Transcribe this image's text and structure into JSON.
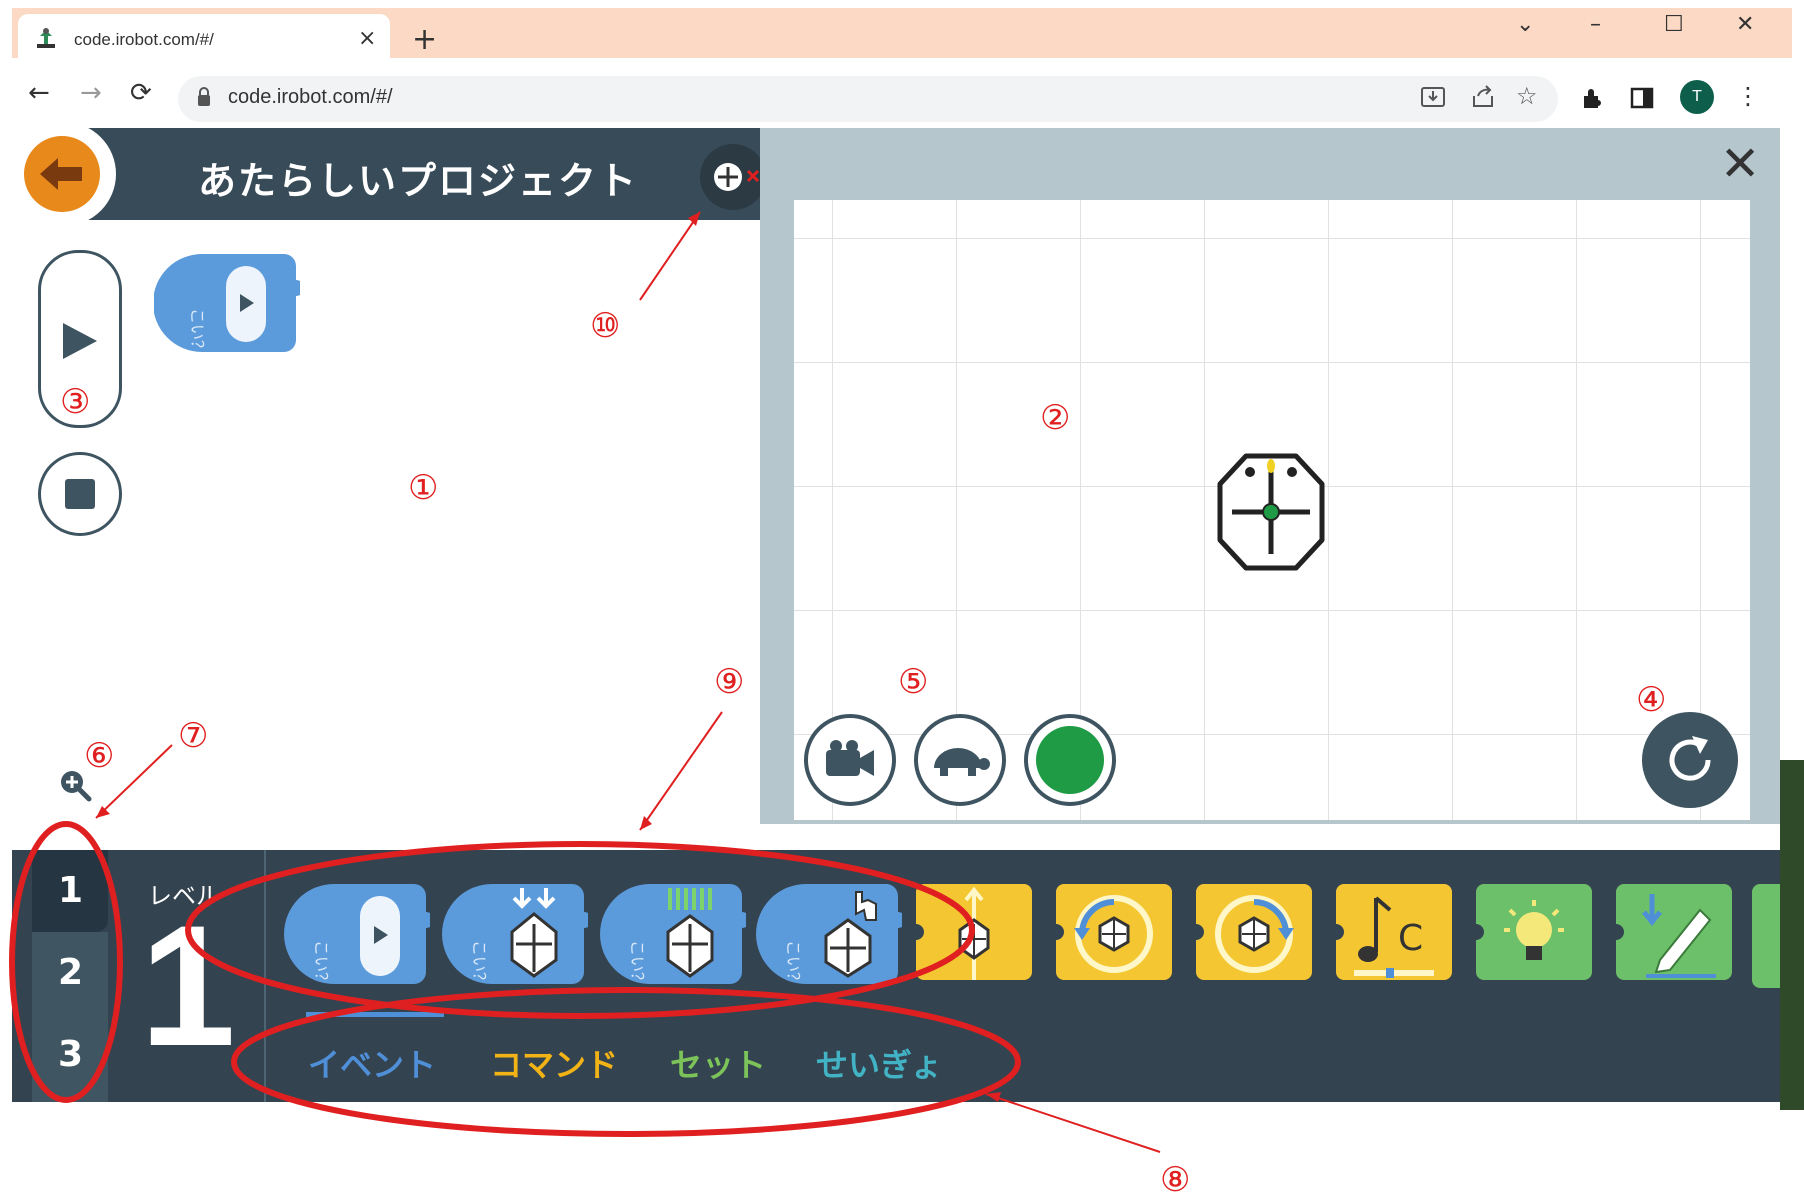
{
  "browser": {
    "tab_title": "code.irobot.com/#/",
    "tab_close": "×",
    "new_tab": "+",
    "window_controls": [
      "⌄",
      "–",
      "☐",
      "✕"
    ],
    "nav": {
      "back": "←",
      "forward": "→",
      "reload": "⟳"
    },
    "url": "code.irobot.com/#/",
    "profile_initial": "T"
  },
  "app": {
    "project_title": "あたらしいプロジェクト",
    "level_label": "レベル",
    "level_big": "1",
    "levels": [
      "1",
      "2",
      "3"
    ],
    "categories": [
      {
        "label": "イベント",
        "color": "#4f8fd8"
      },
      {
        "label": "コマンド",
        "color": "#f2b316"
      },
      {
        "label": "セット",
        "color": "#7cc35a"
      },
      {
        "label": "せいぎょ",
        "color": "#42b3c5"
      }
    ],
    "block_hint": "こい？",
    "note_block_label": "C",
    "colors": {
      "header": "#384b58",
      "palette": "#334350",
      "event_block": "#5b9bdb",
      "command_block": "#f4c732",
      "set_block": "#6cc06a",
      "back_button": "#e8891b",
      "green_light": "#1f9a45"
    }
  },
  "annotations": [
    "①",
    "②",
    "③",
    "④",
    "⑤",
    "⑥",
    "⑦",
    "⑧",
    "⑨",
    "⑩"
  ]
}
